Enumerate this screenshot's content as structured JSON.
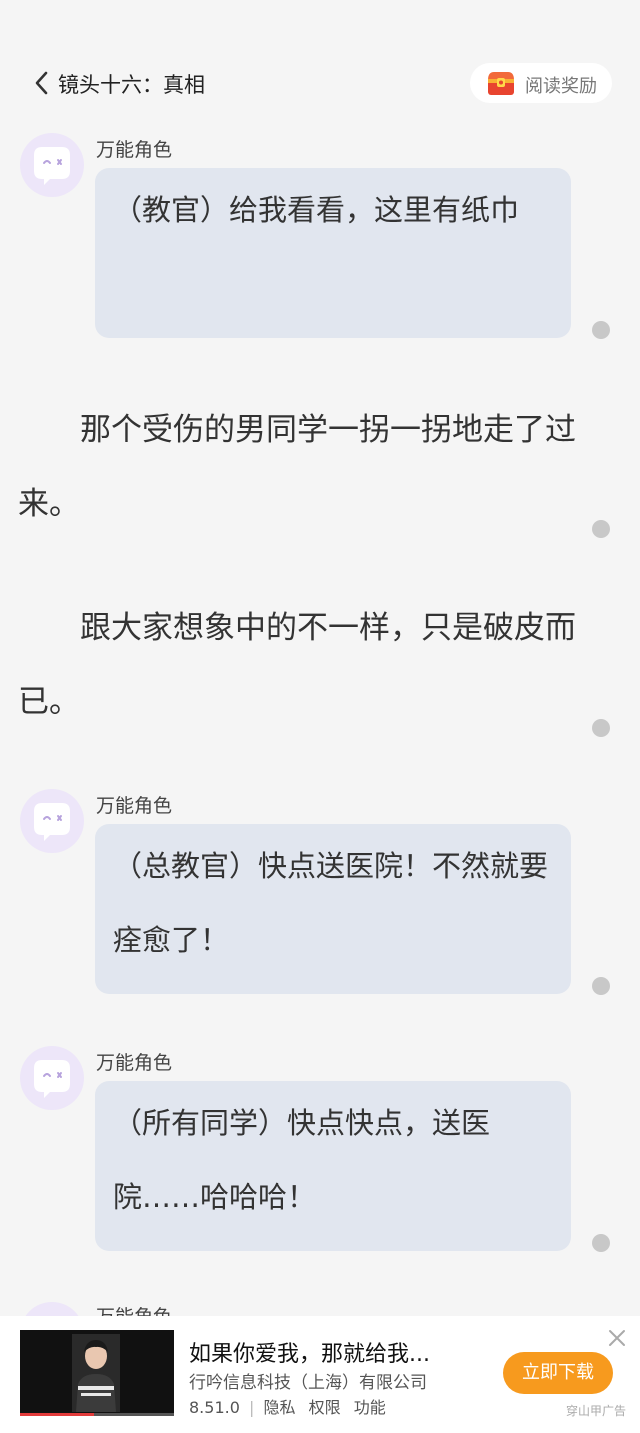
{
  "header": {
    "chapter_title": "镜头十六：真相",
    "reward_label": "阅读奖励"
  },
  "messages": [
    {
      "type": "dialogue",
      "speaker": "万能角色",
      "text": "（教官）给我看看，这里有纸巾"
    },
    {
      "type": "narration",
      "text": "那个受伤的男同学一拐一拐地走了过来。"
    },
    {
      "type": "narration",
      "text": "跟大家想象中的不一样，只是破皮而已。"
    },
    {
      "type": "dialogue",
      "speaker": "万能角色",
      "text": "（总教官）快点送医院！不然就要痊愈了！"
    },
    {
      "type": "dialogue",
      "speaker": "万能角色",
      "text": "（所有同学）快点快点，送医院……哈哈哈！"
    },
    {
      "type": "dialogue",
      "speaker": "万能角色",
      "text": ""
    }
  ],
  "ad": {
    "title": "如果你爱我，那就给我...",
    "company": "行吟信息科技（上海）有限公司",
    "version": "8.51.0",
    "separator": "|",
    "privacy": "隐私",
    "permissions": "权限",
    "features": "功能",
    "cta": "立即下载",
    "source": "穿山甲广告",
    "progress": 0.48
  },
  "colors": {
    "accent": "#f79a1e",
    "bubble": "#e1e6ef",
    "avatar": "#ede6f9"
  },
  "icons": {
    "back": "chevron-left-icon",
    "reward": "treasure-chest-icon",
    "avatar": "chat-bubble-face-icon",
    "close": "close-icon"
  }
}
